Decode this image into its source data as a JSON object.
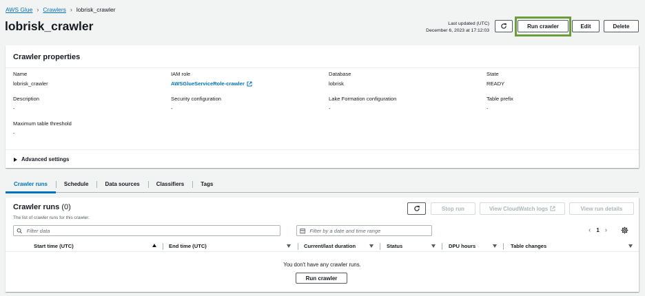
{
  "breadcrumb": {
    "items": [
      "AWS Glue",
      "Crawlers"
    ],
    "current": "lobrisk_crawler"
  },
  "header": {
    "title": "lobrisk_crawler",
    "updated_label": "Last updated (UTC)",
    "updated_value": "December 6, 2023 at 17:12:03",
    "run_label": "Run crawler",
    "edit_label": "Edit",
    "delete_label": "Delete"
  },
  "properties": {
    "title": "Crawler properties",
    "fields": [
      {
        "label": "Name",
        "value": "lobrisk_crawler"
      },
      {
        "label": "IAM role",
        "value": "AWSGlueServiceRole-crawler"
      },
      {
        "label": "Database",
        "value": "lobrisk"
      },
      {
        "label": "State",
        "value": "READY"
      },
      {
        "label": "Description",
        "value": "-"
      },
      {
        "label": "Security configuration",
        "value": "-"
      },
      {
        "label": "Lake Formation configuration",
        "value": "-"
      },
      {
        "label": "Table prefix",
        "value": "-"
      },
      {
        "label": "Maximum table threshold",
        "value": "-"
      }
    ],
    "advanced": "Advanced settings"
  },
  "tabs": [
    "Crawler runs",
    "Schedule",
    "Data sources",
    "Classifiers",
    "Tags"
  ],
  "runs": {
    "title": "Crawler runs",
    "count": "(0)",
    "description": "The list of crawler runs for this crawler.",
    "stop_label": "Stop run",
    "cloudwatch_label": "View CloudWatch logs",
    "details_label": "View run details",
    "filter_placeholder": "Filter data",
    "date_placeholder": "Filter by a date and time range",
    "page": "1",
    "columns": [
      "Start time (UTC)",
      "End time (UTC)",
      "Current/last duration",
      "Status",
      "DPU hours",
      "Table changes"
    ],
    "empty_message": "You don't have any crawler runs.",
    "empty_button": "Run crawler"
  },
  "colors": {
    "accent": "#0073bb",
    "highlight": "#6b9c3a"
  }
}
